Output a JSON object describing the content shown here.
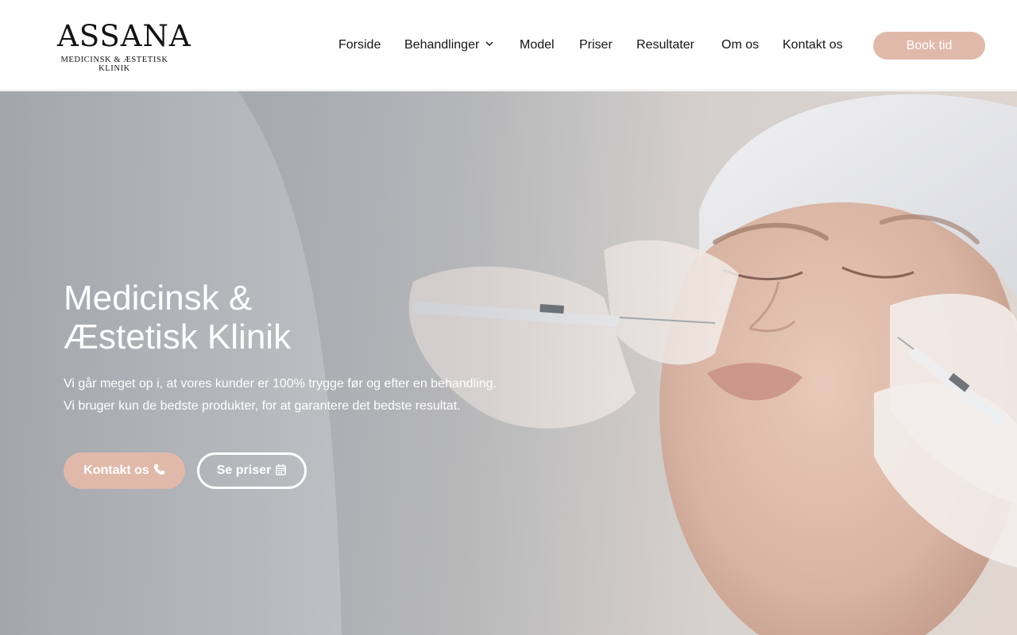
{
  "brand": {
    "name": "ASSANA",
    "tagline": "Medicinsk & Æstetisk Klinik"
  },
  "nav": {
    "items": [
      {
        "label": "Forside"
      },
      {
        "label": "Behandlinger",
        "icon": "chevron-down-icon"
      },
      {
        "label": "Model"
      },
      {
        "label": "Priser"
      },
      {
        "label": "Resultater"
      },
      {
        "label": "Om os"
      },
      {
        "label": "Kontakt os"
      }
    ],
    "cta_label": "Book tid"
  },
  "hero": {
    "title_line1": "Medicinsk &",
    "title_line2": "Æstetisk Klinik",
    "text_line1": "Vi går meget op i, at vores kunder er 100% trygge før og efter en behandling.",
    "text_line2": "Vi bruger kun de bedste produkter, for at garantere det bedste resultat.",
    "primary_button": {
      "label": "Kontakt os",
      "icon": "phone-icon"
    },
    "secondary_button": {
      "label": "Se priser",
      "icon": "calendar-icon"
    }
  },
  "colors": {
    "accent": "#e1b9aa",
    "header_bg": "#ffffff",
    "hero_text": "#ffffff",
    "nav_text": "#141414"
  }
}
